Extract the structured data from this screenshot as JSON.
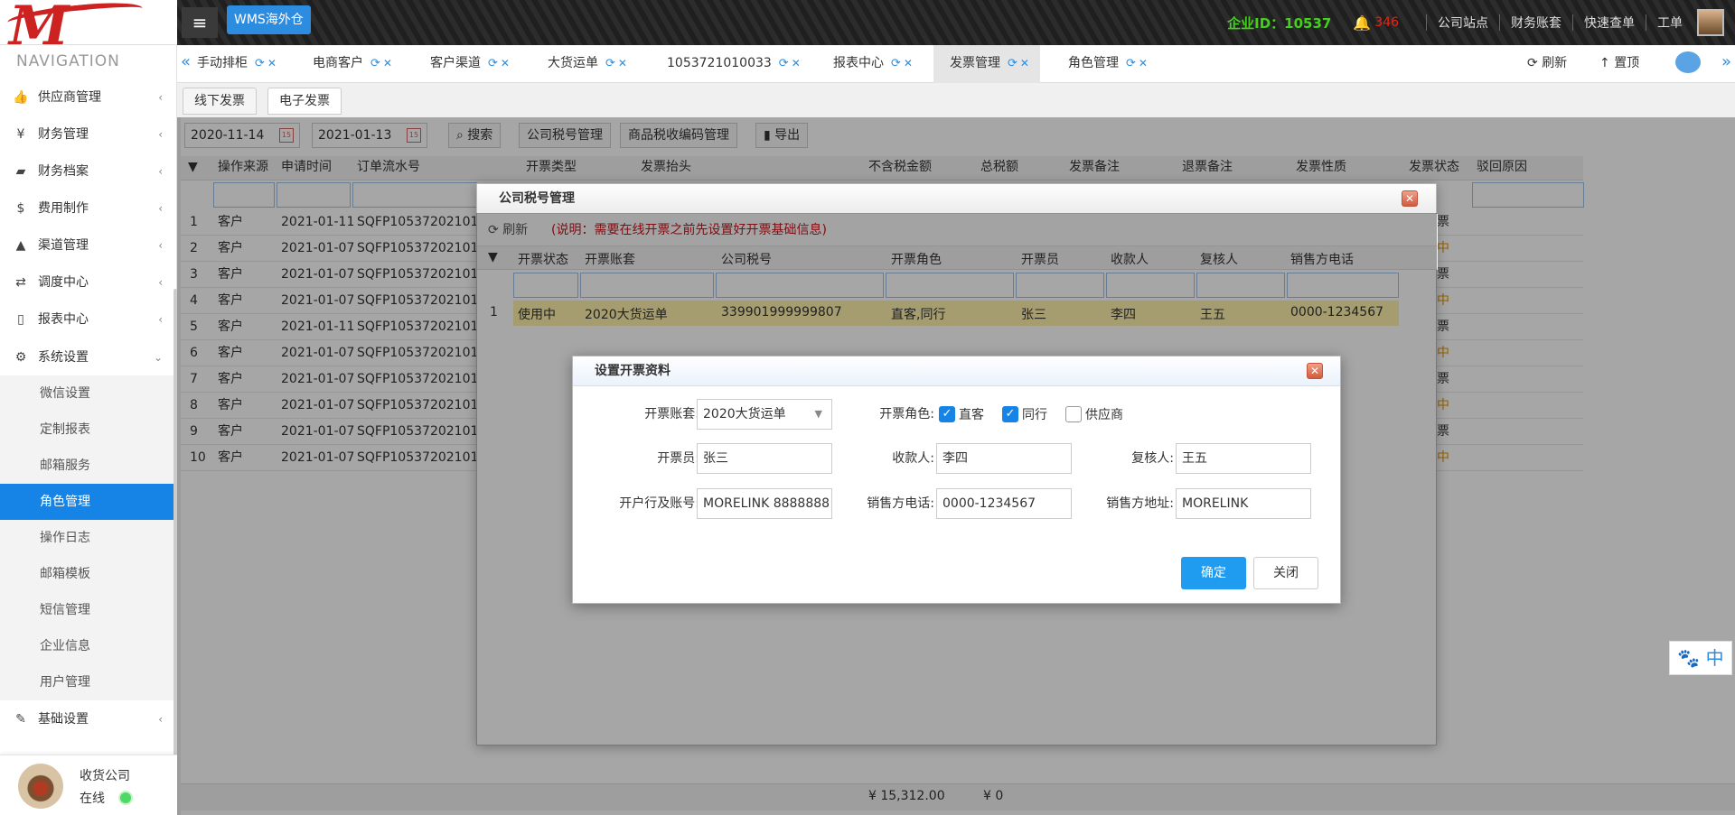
{
  "app": {
    "badge": "WMS海外仓",
    "enterprise_id": "企业ID：10537",
    "notif_count": "346",
    "top_links": [
      "公司站点",
      "财务账套",
      "快速查单",
      "工单"
    ]
  },
  "sidebar": {
    "title": "NAVIGATION",
    "items": [
      {
        "label": "供应商管理",
        "icon": "thumbs-up-icon"
      },
      {
        "label": "财务管理",
        "icon": "yen-icon"
      },
      {
        "label": "财务档案",
        "icon": "book-icon"
      },
      {
        "label": "费用制作",
        "icon": "dollar-icon"
      },
      {
        "label": "渠道管理",
        "icon": "road-icon"
      },
      {
        "label": "调度中心",
        "icon": "retweet-icon"
      },
      {
        "label": "报表中心",
        "icon": "file-icon"
      },
      {
        "label": "系统设置",
        "icon": "gear-icon"
      }
    ],
    "subitems": [
      "微信设置",
      "定制报表",
      "邮箱服务",
      "角色管理",
      "操作日志",
      "邮箱模板",
      "短信管理",
      "企业信息",
      "用户管理"
    ],
    "last_item": {
      "label": "基础设置",
      "icon": "edit-icon"
    },
    "user": {
      "name": "收货公司",
      "status": "在线"
    }
  },
  "tabs": [
    "手动排柜",
    "电商客户",
    "客户渠道",
    "大货运单",
    "1053721010033",
    "报表中心",
    "发票管理",
    "角色管理"
  ],
  "tab_actions": {
    "refresh": "刷新",
    "top": "置顶"
  },
  "subtabs": [
    "线下发票",
    "电子发票"
  ],
  "toolbar": {
    "date_from": "2020-11-14",
    "date_to": "2021-01-13",
    "search": "搜索",
    "tax_mgmt": "公司税号管理",
    "goods_code": "商品税收编码管理",
    "export": "导出"
  },
  "grid": {
    "headers": [
      "操作来源",
      "申请时间",
      "订单流水号",
      "开票类型",
      "发票抬头",
      "不含税金额",
      "总税额",
      "发票备注",
      "退票备注",
      "发票性质",
      "发票状态",
      "驳回原因"
    ],
    "rows": [
      {
        "n": "1",
        "src": "客户",
        "time": "2021-01-11",
        "order": "SQFP10537202101",
        "status": "票"
      },
      {
        "n": "2",
        "src": "客户",
        "time": "2021-01-07",
        "order": "SQFP10537202101",
        "status": "中"
      },
      {
        "n": "3",
        "src": "客户",
        "time": "2021-01-07",
        "order": "SQFP10537202101",
        "status": "票"
      },
      {
        "n": "4",
        "src": "客户",
        "time": "2021-01-07",
        "order": "SQFP10537202101",
        "status": "中"
      },
      {
        "n": "5",
        "src": "客户",
        "time": "2021-01-11",
        "order": "SQFP10537202101",
        "status": "票"
      },
      {
        "n": "6",
        "src": "客户",
        "time": "2021-01-07",
        "order": "SQFP10537202101",
        "status": "中"
      },
      {
        "n": "7",
        "src": "客户",
        "time": "2021-01-07",
        "order": "SQFP10537202101",
        "status": "票"
      },
      {
        "n": "8",
        "src": "客户",
        "time": "2021-01-07",
        "order": "SQFP10537202101",
        "status": "中"
      },
      {
        "n": "9",
        "src": "客户",
        "time": "2021-01-07",
        "order": "SQFP10537202101",
        "status": "票"
      },
      {
        "n": "10",
        "src": "客户",
        "time": "2021-01-07",
        "order": "SQFP10537202101",
        "status": "中"
      }
    ],
    "footer": {
      "amount": "¥ 15,312.00",
      "tax": "¥ 0"
    }
  },
  "dialog1": {
    "title": "公司税号管理",
    "refresh": "刷新",
    "note": "(说明：需要在线开票之前先设置好开票基础信息)",
    "headers": [
      "开票状态",
      "开票账套",
      "公司税号",
      "开票角色",
      "开票员",
      "收款人",
      "复核人",
      "销售方电话"
    ],
    "row": {
      "n": "1",
      "status": "使用中",
      "account": "2020大货运单",
      "taxno": "339901999999807",
      "role": "直客,同行",
      "clerk": "张三",
      "payee": "李四",
      "reviewer": "王五",
      "phone": "0000-1234567"
    }
  },
  "dialog2": {
    "title": "设置开票资料",
    "account_label": "开票账套:",
    "account_value": "2020大货运单",
    "role_label": "开票角色:",
    "roles": [
      {
        "label": "直客",
        "checked": true
      },
      {
        "label": "同行",
        "checked": true
      },
      {
        "label": "供应商",
        "checked": false
      }
    ],
    "clerk_label": "开票员:",
    "clerk_value": "张三",
    "payee_label": "收款人:",
    "payee_value": "李四",
    "reviewer_label": "复核人:",
    "reviewer_value": "王五",
    "bank_label": "开户行及账号:",
    "bank_value": "MORELINK 8888888",
    "phone_label": "销售方电话:",
    "phone_value": "0000-1234567",
    "address_label": "销售方地址:",
    "address_value": "MORELINK",
    "ok": "确定",
    "close": "关闭"
  },
  "ime": "中"
}
